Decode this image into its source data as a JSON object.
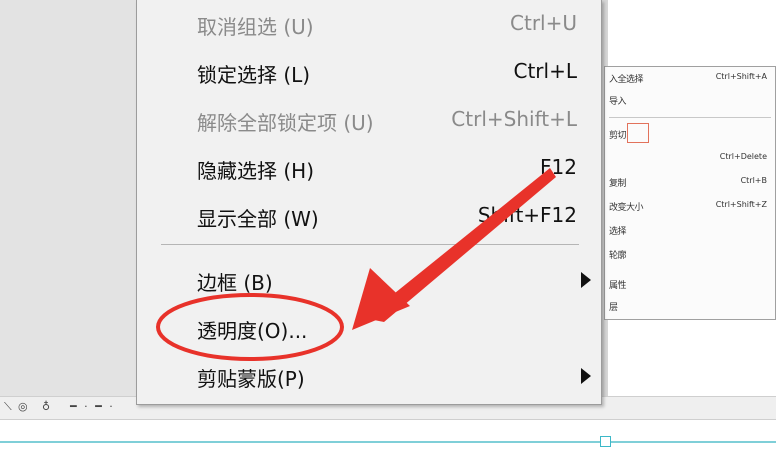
{
  "menu": {
    "items": [
      {
        "label": "取消组选 (U)",
        "shortcut": "Ctrl+U",
        "disabled": true
      },
      {
        "label": "锁定选择 (L)",
        "shortcut": "Ctrl+L",
        "disabled": false
      },
      {
        "label": "解除全部锁定项 (U)",
        "shortcut": "Ctrl+Shift+L",
        "disabled": true
      },
      {
        "label": "隐藏选择 (H)",
        "shortcut": "F12",
        "disabled": false
      },
      {
        "label": "显示全部 (W)",
        "shortcut": "Shift+F12",
        "disabled": false
      },
      {
        "label": "边框 (B)",
        "shortcut": "",
        "disabled": false,
        "submenu": true
      },
      {
        "label": "透明度(O)...",
        "shortcut": "",
        "disabled": false,
        "highlighted": true
      },
      {
        "label": "剪贴蒙版(P)",
        "shortcut": "",
        "disabled": false,
        "submenu": true
      }
    ]
  },
  "background_menu": {
    "rows": [
      {
        "label": "入全选择",
        "shortcut": "Ctrl+Shift+A"
      },
      {
        "label": "导入",
        "shortcut": ""
      },
      {
        "label": "剪切",
        "shortcut": ""
      },
      {
        "label": "",
        "shortcut": "Ctrl+Delete"
      },
      {
        "label": "复制",
        "shortcut": "Ctrl+B"
      },
      {
        "label": "改变大小",
        "shortcut": "Ctrl+Shift+Z"
      },
      {
        "label": "选择",
        "shortcut": ""
      },
      {
        "label": "轮廓",
        "shortcut": ""
      },
      {
        "label": "",
        "shortcut": ""
      },
      {
        "label": "属性",
        "shortcut": ""
      },
      {
        "label": "层",
        "shortcut": ""
      }
    ]
  },
  "colors": {
    "annotation": "#e8322a",
    "menu_bg": "#f1f1f1",
    "canvas_guide": "#7fcfd8"
  },
  "icons": {
    "submenu_arrow": "triangle-right-icon",
    "annotation_arrow": "red-arrow-icon",
    "annotation_circle": "red-ellipse-icon"
  }
}
